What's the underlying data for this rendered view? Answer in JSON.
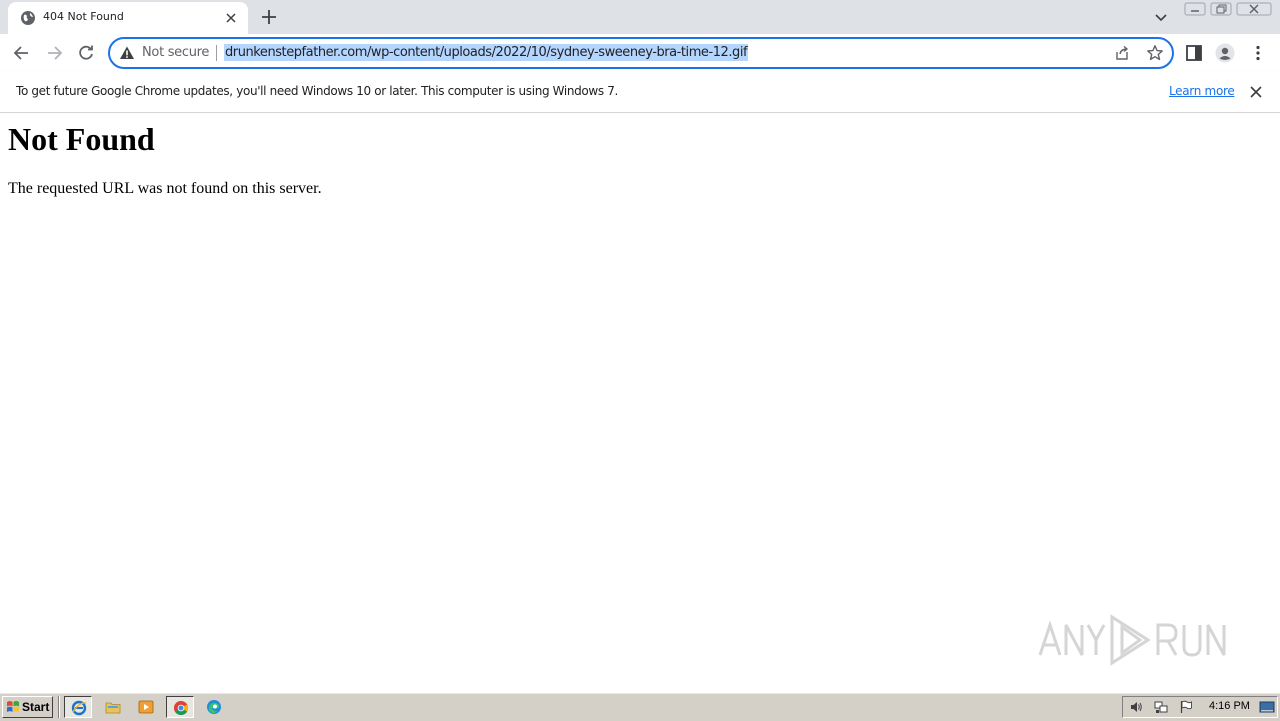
{
  "browser": {
    "tab": {
      "title": "404 Not Found"
    },
    "omnibox": {
      "security_label": "Not secure",
      "url": "drunkenstepfather.com/wp-content/uploads/2022/10/sydney-sweeney-bra-time-12.gif"
    },
    "infobar": {
      "message": "To get future Google Chrome updates, you'll need Windows 10 or later. This computer is using Windows 7.",
      "link_label": "Learn more"
    }
  },
  "page": {
    "heading": "Not Found",
    "body": "The requested URL was not found on this server."
  },
  "watermark": {
    "text": "ANY RUN"
  },
  "taskbar": {
    "start_label": "Start",
    "pinned_apps": [
      "internet-explorer-icon",
      "folder-icon",
      "media-player-icon",
      "chrome-icon",
      "edge-icon"
    ],
    "tray_icons": [
      "volume-icon",
      "network-icon",
      "action-center-flag-icon",
      "show-desktop-icon"
    ],
    "clock": "4:16 PM"
  },
  "colors": {
    "accent": "#1a73e8",
    "tabstrip": "#dee1e6",
    "url_selection": "#b4d5fe",
    "taskbar": "#d4d0c8"
  }
}
